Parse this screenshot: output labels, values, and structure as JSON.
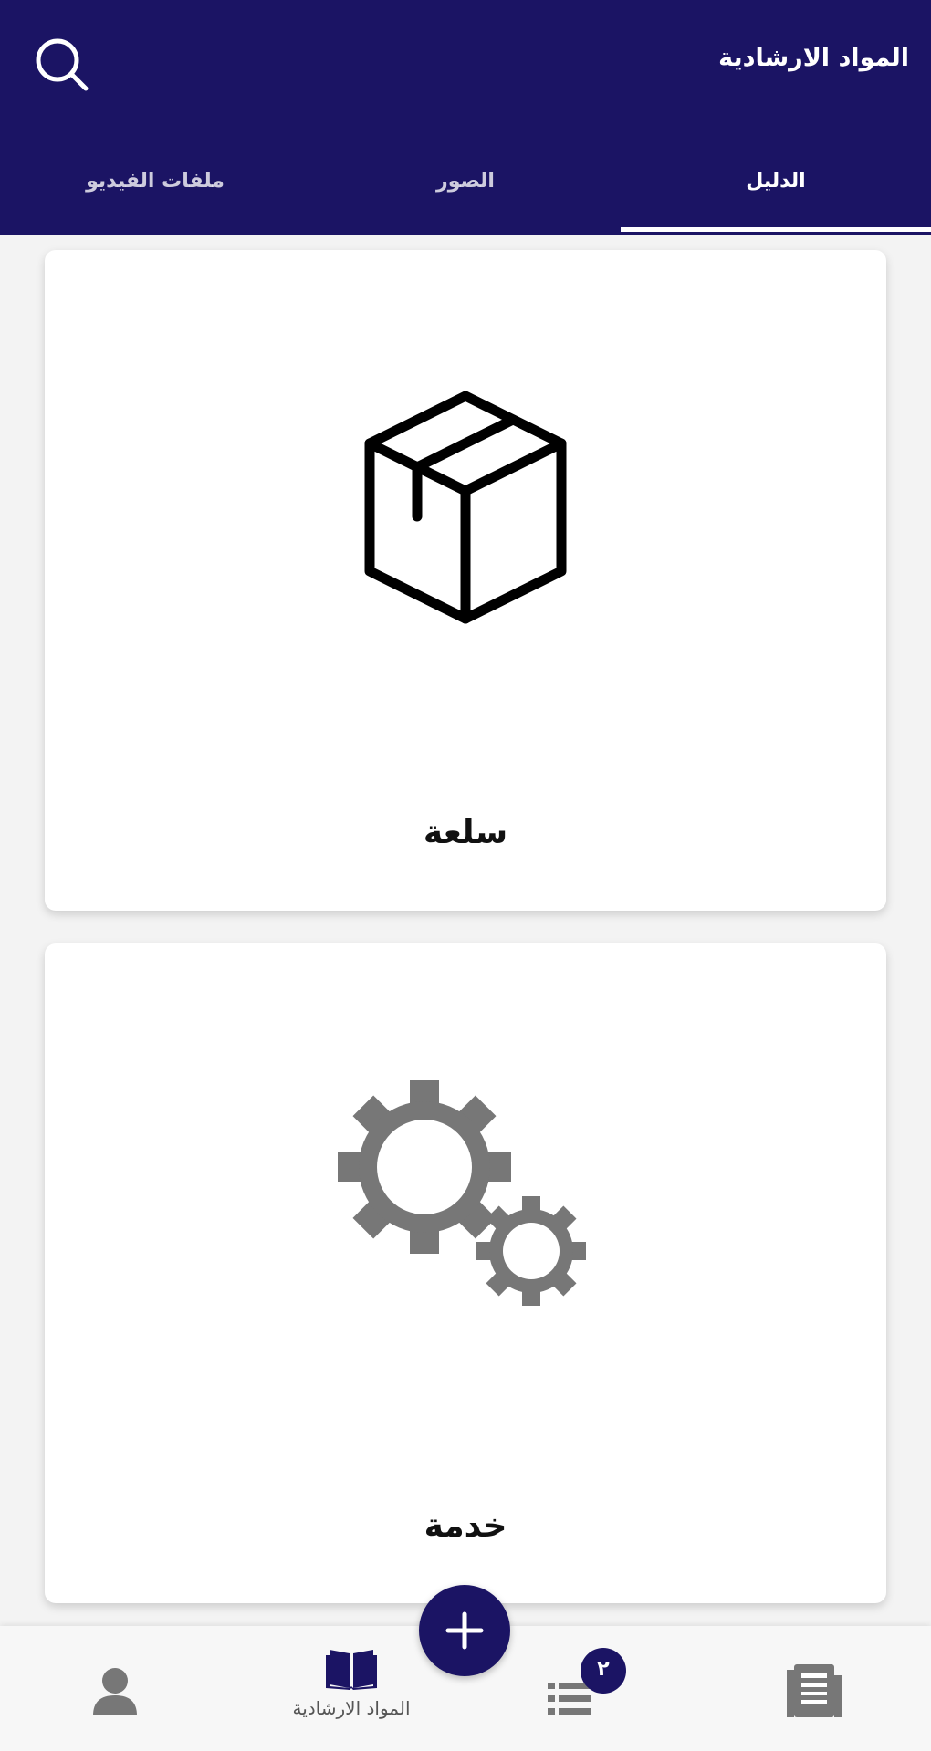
{
  "header": {
    "title": "المواد الارشادية",
    "search_icon": "search-icon"
  },
  "tabs": [
    {
      "label": "الدليل",
      "active": true
    },
    {
      "label": "الصور",
      "active": false
    },
    {
      "label": "ملفات الفيديو",
      "active": false
    }
  ],
  "cards": [
    {
      "label": "سلعة",
      "icon": "box-icon"
    },
    {
      "label": "خدمة",
      "icon": "gears-icon"
    }
  ],
  "bottom_nav": {
    "docs_icon": "newspaper-icon",
    "list_icon": "list-icon",
    "list_badge": "٢",
    "guide_label": "المواد الارشادية",
    "guide_icon": "open-book-icon",
    "profile_icon": "user-icon",
    "fab_icon": "plus-icon"
  },
  "colors": {
    "primary": "#1b1464",
    "background": "#f3f3f3",
    "card": "#ffffff",
    "icon_gray": "#777777"
  }
}
